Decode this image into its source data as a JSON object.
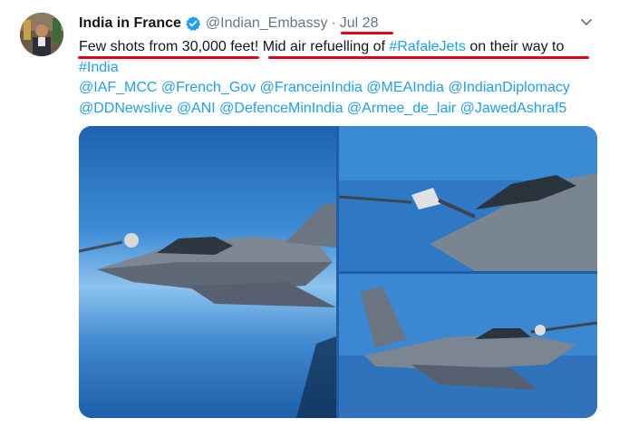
{
  "tweet": {
    "display_name": "India in France",
    "handle": "@Indian_Embassy",
    "separator": "·",
    "date": "Jul 28",
    "text": {
      "line1_plain": "Few shots from 30,000 feet! Mid air refuelling of ",
      "line1_hashtag": "#RafaleJets",
      "line1_tail": " on their way to",
      "line2_hashtag": "#India",
      "mentions_line1": "@IAF_MCC @French_Gov @FranceinIndia @MEAIndia @IndianDiplomacy",
      "mentions_line2": "@DDNewslive @ANI @DefenceMinIndia @Armee_de_lair @JawedAshraf5"
    }
  },
  "icons": {
    "verified": "verified-badge-icon",
    "menu": "chevron-down-icon"
  },
  "colors": {
    "link": "#1da1f2",
    "muted": "#657786",
    "highlight_underline": "#e6001a",
    "verified": "#1da1f2"
  },
  "media": {
    "photos": [
      {
        "name": "rafale-refuelling-photo-1"
      },
      {
        "name": "rafale-refuelling-photo-2"
      },
      {
        "name": "rafale-refuelling-photo-3"
      }
    ]
  }
}
